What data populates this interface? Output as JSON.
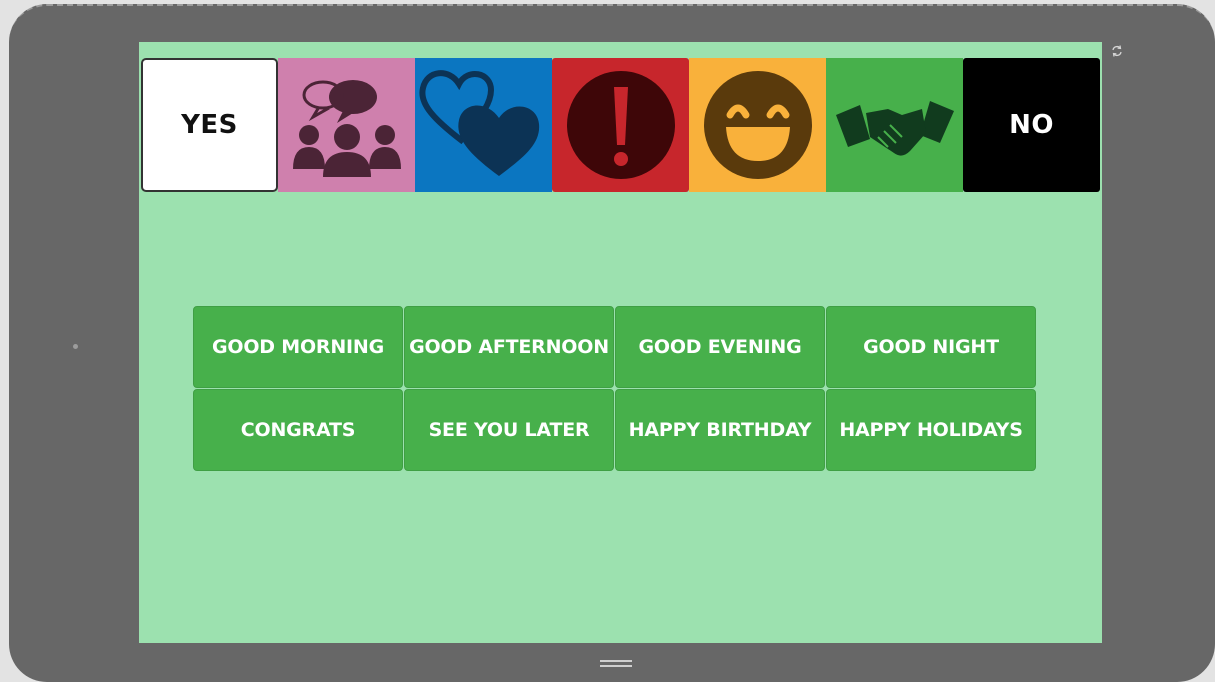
{
  "device": {
    "icons": [
      "rotate-icon",
      "home-bar-icon"
    ],
    "frame_color": "#676767"
  },
  "board": {
    "background": "#9ce1af",
    "top_row": [
      {
        "id": "yes",
        "label": "YES",
        "color": "#ffffff",
        "text_color": "#111111"
      },
      {
        "id": "people",
        "icon": "people-talking-icon",
        "color": "#cf80ad"
      },
      {
        "id": "love",
        "icon": "hearts-icon",
        "color": "#0b76c1"
      },
      {
        "id": "alert",
        "icon": "exclamation-icon",
        "color": "#c7262c"
      },
      {
        "id": "happy",
        "icon": "smiley-face-icon",
        "color": "#f9b13b"
      },
      {
        "id": "deal",
        "icon": "handshake-icon",
        "color": "#47b04b"
      },
      {
        "id": "no",
        "label": "NO",
        "color": "#000000",
        "text_color": "#ffffff"
      }
    ],
    "phrases": [
      [
        "GOOD MORNING",
        "GOOD AFTERNOON",
        "GOOD EVENING",
        "GOOD NIGHT"
      ],
      [
        "CONGRATS",
        "SEE YOU LATER",
        "HAPPY BIRTHDAY",
        "HAPPY HOLIDAYS"
      ]
    ],
    "phrase_color": "#47b04b"
  }
}
